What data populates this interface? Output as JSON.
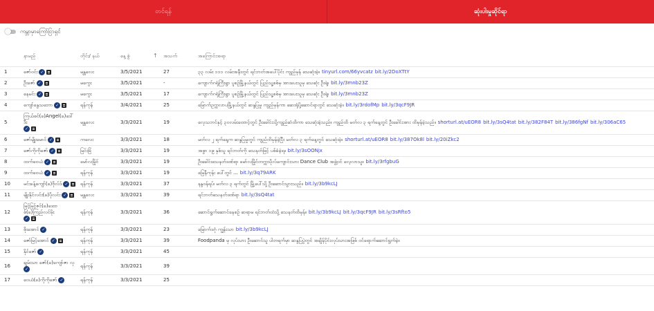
{
  "tabs": [
    {
      "label": "တင်ရန်"
    },
    {
      "label": "ဆုံးပါးမှုဆိုင်ရာ"
    }
  ],
  "toggle": {
    "label": "ကမ္ဘာမှာကြော်ငြာရှင်"
  },
  "table": {
    "headers": {
      "no": "",
      "name": "နာမည်",
      "region": "တိုင်း/ နယ်",
      "date": "နေ့ စွဲ",
      "count": "အသက်",
      "news": "အကြောင်းအရာ"
    },
    "rows": [
      {
        "no": "1",
        "name": "ဇော်ဝင်း",
        "verified": true,
        "doc": true,
        "region": "မန္တလေး",
        "date": "3/5/2021",
        "count": "27",
        "news": "၃၃ လမ်း ၁၁၁ လမ်းအနီးတွင် ရင်ဘတ်အပေါ်ပိုင်း ကျည်မှန် သေဆုံးခဲ့။",
        "links": [
          "tinyurl.com/66yvcatz",
          "bit.ly/2DoXTtY"
        ]
      },
      {
        "no": "2",
        "name": "ဦးဇော်",
        "verified": true,
        "doc": true,
        "region": "မကွေး",
        "date": "3/5/2021",
        "count": "-",
        "news": "ကျောက်ဂရုံကြီးရွာ ပူစဉ်မြို့နယ်တွင် ပြည်သူ့စစ်မှ အားပေးသူမှ သေဆုံး ဦးရဲ့။",
        "links": [
          "bit.ly/3mnb23Z"
        ]
      },
      {
        "no": "3",
        "name": "နေမင်း",
        "verified": true,
        "doc": true,
        "region": "မကွေး",
        "date": "3/5/2021",
        "count": "17",
        "news": "ကျောက်ဂရုံကြီးရွာ ပူစဉ်မြို့နယ်တွင် ပြည်သူ့စစ်မှ အားပေးသူမှ သေဆုံး ဦးရဲ့။",
        "links": [
          "bit.ly/3mnb23Z"
        ]
      },
      {
        "no": "4",
        "name": "ကျော်နွေသဘော",
        "verified": true,
        "doc": true,
        "region": "ရန်ကုန်",
        "date": "3/4/2021",
        "count": "25",
        "news": "မြောက်ဥက္ကလာပမြို့နယ်တွင် ဆန္ဒပြမှု ကျည်မှန်ကာ ဆေးရုံပို့ဆောင်ရာတွင် သေဆုံးခဲ့။",
        "links": [
          "bit.ly/3rdofMp",
          "bit.ly/3qcF9JR"
        ]
      },
      {
        "no": "5",
        "name": "ကြယ်စင်(ခ)Angel(ခ)ဒေါ်ဒီး",
        "verified": true,
        "doc": true,
        "region": "မန္တလေး",
        "date": "3/3/2021",
        "count": "19",
        "news": "လှေသဘင်နှင့် ၃၀လမ်းထောင့်တွင် ဦးခေါင်းသို့ကျည်ဆံထိကာ သေဆုံးခဲ့သည်။ ကျည်ထိ မတ်လ ၃ ရက်နေ့တွင် ဦးခေါင်းအား ထိမှန်ခဲ့သည်။",
        "links": [
          "shorturl.at/uEOR8",
          "bit.ly/3sQ4tat",
          "bit.ly/382F84T",
          "bit.ly/386fgNf",
          "bit.ly/306aC65"
        ]
      },
      {
        "no": "6",
        "name": "ဇော်မျိုးမောင်",
        "verified": true,
        "doc": true,
        "region": "ကလေး",
        "date": "3/3/2021",
        "count": "18",
        "news": "မတ်လ ၂ ရက်နေ့က ဆန္ဒပြမှုတွင် ကျည်ထိမှန်ခဲ့ပြီး မတ်လ ၃ ရက်နေ့တွင် သေဆုံးခဲ့။",
        "links": [
          "shorturl.at/uEOR8",
          "bit.ly/387Ok8l",
          "bit.ly/20iZkc2"
        ]
      },
      {
        "no": "7",
        "name": "ဇော်ကိုကိုဇော်",
        "verified": true,
        "doc": true,
        "region": "မြင်းခြံ",
        "date": "3/3/2021",
        "count": "19",
        "news": "အဖွာ ၁၉ နှစ်သူ ရင်ဘတ်ကို သေနတ်ဖြင့် ပစ်ခံခဲ့ရ။",
        "links": [
          "bit.ly/3sOONjx"
        ]
      },
      {
        "no": "8",
        "name": "ထက်ဝေယံ",
        "verified": true,
        "doc": true,
        "region": "မော်လမြိုင်",
        "date": "3/3/2021",
        "count": "19",
        "news": "ဦးခေါင်းသေနတ်ဒဏ်ရာ မော်လမြိုင်တက္ကသိုလ်ကျောင်းသား Dance Club အဖွဲ့ဝင် လေ့လာသူ။",
        "links": [
          "bit.ly/3rfgbuG"
        ]
      },
      {
        "no": "9",
        "name": "ထက်ဝေယံ",
        "verified": true,
        "doc": true,
        "region": "ရန်ကုန်",
        "date": "3/3/2021",
        "count": "19",
        "news": "မြေနီကုန်း ပေါ်တွင် ...",
        "links": [
          "bit.ly/3q79ARK"
        ]
      },
      {
        "no": "10",
        "name": "မင်းခန့်ကျော်(ခ)ဗိုလ်ဒ်",
        "verified": true,
        "doc": true,
        "region": "ရန်ကုန်",
        "date": "3/3/2021",
        "count": "37",
        "news": "နန္ဒဝန်ရပ်၊ မတ်လ ၃ ရက်တွင် မြို့ပေါ်သို့ ဦးဆောင်သွားသည်။",
        "links": [
          "bit.ly/3b9kcLJ"
        ]
      },
      {
        "no": "11",
        "name": "မျိုးနိုင်လင်း(ခ)ပိုလင်း",
        "verified": true,
        "doc": true,
        "region": "မန္တလေး",
        "date": "3/3/2021",
        "count": "39",
        "news": "ရင်ဘတ်သေနတ်ဒဏ်ရာ",
        "links": [
          "bit.ly/3sQ4tat"
        ]
      },
      {
        "no": "12",
        "name": "မြင့်မြင့်ဇင်(ခ)ဒေးဗစ်(ခ)ကြည်လင်မိုး",
        "verified": true,
        "doc": true,
        "region": "ရန်ကုန်",
        "date": "3/3/2021",
        "count": "36",
        "news": "ဆောင်ရွက်ဆောင်နေစဉ် ဆရာမ ရင်ဘတ်ထဲသို့ သေနတ်ထိမှန်။",
        "links": [
          "bit.ly/3b9kcLJ",
          "bit.ly/3qcF9JR",
          "bit.ly/3sRfto5"
        ]
      },
      {
        "no": "13",
        "name": "စိုးအောင်",
        "verified": true,
        "doc": false,
        "region": "ရန်ကုန်",
        "date": "3/3/2021",
        "count": "23",
        "news": "မြောက်ဒဂုံ ကျွန်းသာ",
        "links": [
          "bit.ly/3b9kcLJ"
        ]
      },
      {
        "no": "14",
        "name": "ဇော်မြင့်အောင်",
        "verified": true,
        "doc": true,
        "region": "ရန်ကုန်",
        "date": "3/3/2021",
        "count": "39",
        "news": "Foodpanda မှ လုပ်သား ဦးဆောင်သူ ပါတရက်မှာ ဆန္ဒပြပွဲတွင် အချိန်ပိုင်းလုပ်သားအဖြစ် ဝင်ရောက်ဆောင်ရွက်ခဲ့။",
        "links": []
      },
      {
        "no": "15",
        "name": "နိုင်ဇော်",
        "verified": true,
        "doc": false,
        "region": "ရန်ကုန်",
        "date": "3/3/2021",
        "count": "45",
        "news": "",
        "links": []
      },
      {
        "no": "16",
        "name": "ချမ်းသာ ဇော်(ခ)ကျော်ဇာ လှ",
        "verified": true,
        "doc": false,
        "region": "ရန်ကုန်",
        "date": "3/3/2021",
        "count": "39",
        "news": "",
        "links": []
      },
      {
        "no": "17",
        "name": "ဝေယံ(ခ)ကိုကိုဇော်",
        "verified": true,
        "doc": false,
        "region": "ရန်ကုန်",
        "date": "3/3/2021",
        "count": "25",
        "news": "",
        "links": []
      }
    ]
  }
}
